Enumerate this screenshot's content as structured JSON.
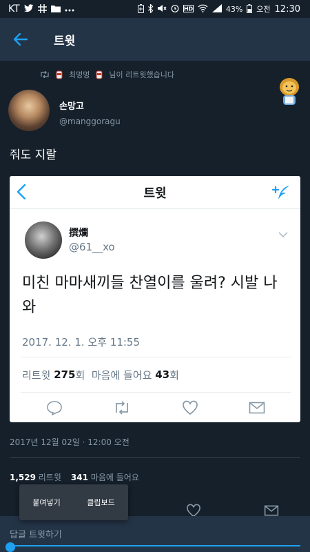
{
  "statusbar": {
    "carrier": "KT",
    "battery": "43%",
    "ampm": "오전",
    "time": "12:30",
    "icons": [
      "twitter-icon",
      "grid-icon",
      "folder-icon",
      "more-icon",
      "battery-saver-icon",
      "bluetooth-icon",
      "mute-icon",
      "alarm-icon",
      "hd-icon",
      "wifi-icon",
      "signal-icon",
      "battery-icon"
    ]
  },
  "appbar": {
    "title": "트윗"
  },
  "retweet": {
    "by": "최멍멍",
    "suffix": "님이 리트윗했습니다"
  },
  "author": {
    "name": "손망고",
    "handle": "@manggoragu"
  },
  "tweet": {
    "text": "줘도 지랄",
    "date": "2017년 12월 02일 · 12:00 오전",
    "retweets": "1,529",
    "retweets_label": "리트윗",
    "likes": "341",
    "likes_label": "마음에 들어요"
  },
  "quoted": {
    "bar_title": "트윗",
    "name": "撰爛",
    "handle": "@61__xo",
    "text": "미친 마마새끼들 찬열이를 울려? 시발 나와",
    "date": "2017. 12. 1. 오후 11:55",
    "rt_label": "리트윗",
    "rt_count": "275",
    "rt_unit": "회",
    "like_label": "마음에 들어요",
    "like_count": "43",
    "like_unit": "회"
  },
  "context_menu": {
    "paste": "붙여넣기",
    "clipboard": "클립보드"
  },
  "reply": {
    "placeholder": "답글 트윗하기"
  },
  "colors": {
    "bg": "#15202b",
    "bar": "#243447",
    "accent": "#1da1f2",
    "muted": "#8899a6"
  }
}
